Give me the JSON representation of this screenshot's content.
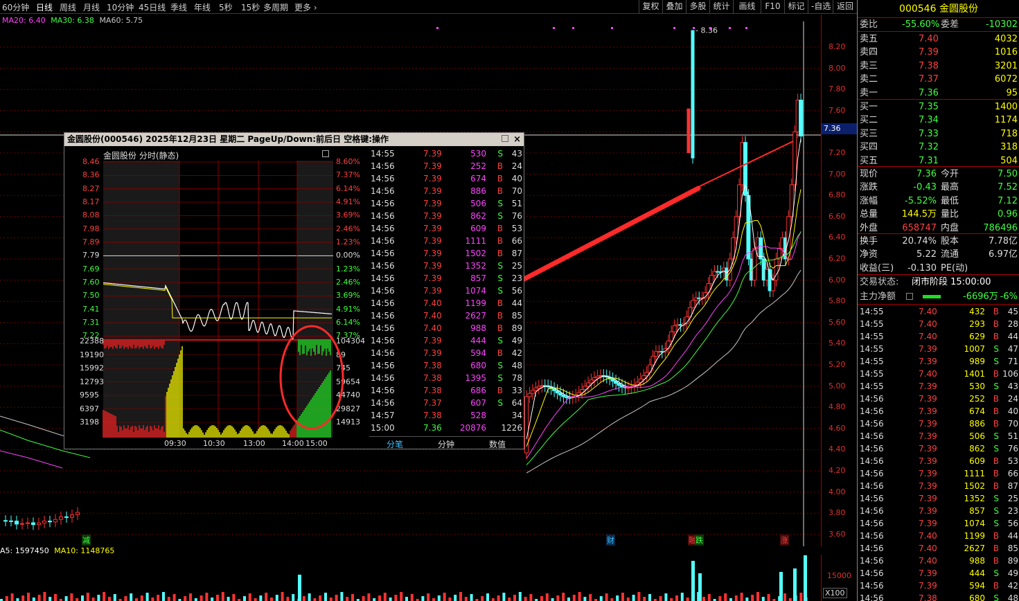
{
  "periods": [
    "60分钟",
    "日线",
    "周线",
    "月线",
    "10分钟",
    "45日线",
    "季线",
    "年线",
    "5秒",
    "15秒",
    "多周期",
    "更多"
  ],
  "active_period": "日线",
  "toolbar": [
    "复权",
    "叠加",
    "多股",
    "统计",
    "画线",
    "F10",
    "标记",
    "-自选",
    "返回"
  ],
  "colors": {
    "up": "#ff3232",
    "down": "#54ffff",
    "ma5": "#ffffff",
    "ma10": "#ffff00",
    "ma20": "#ff00ff",
    "ma30": "#00ff00",
    "ma60": "#c8c8c8",
    "grid": "#8b0000",
    "bg": "#000000",
    "axis": "#e03030"
  },
  "main_chart": {
    "ma_legend": [
      {
        "label": "MA20: 6.40",
        "color": "#ff44ff"
      },
      {
        "label": "MA30: 6.38",
        "color": "#44ff44"
      },
      {
        "label": "MA60: 5.75",
        "color": "#c8c8c8"
      }
    ],
    "price_axis": [
      "8.20",
      "8.00",
      "7.80",
      "7.60",
      "7.40",
      "7.20",
      "7.00",
      "6.80",
      "6.60",
      "6.40",
      "6.20",
      "6.00",
      "5.80",
      "5.60",
      "5.40",
      "5.20",
      "5.00",
      "4.80",
      "4.60",
      "4.40",
      "4.20",
      "4.00",
      "3.80",
      "3.60"
    ],
    "current_price": "7.36",
    "high_marker": "8.36",
    "events": [
      {
        "label": "减",
        "color": "#40ff40"
      },
      {
        "label": "财",
        "color": "#40c0ff"
      },
      {
        "label": "融",
        "color": "#ff4040"
      },
      {
        "label": "跌",
        "color": "#40ff40"
      },
      {
        "label": "涨",
        "color": "#ff4040"
      }
    ],
    "volume_legend": [
      {
        "label": "A5: 1597450",
        "color": "#ffffff"
      },
      {
        "label": "MA10: 1148765",
        "color": "#ffff00"
      }
    ],
    "volume_axis": [
      "15000",
      "X100"
    ]
  },
  "popup": {
    "title": "金圆股份(000546)  2025年12月23日  星期二  PageUp/Down:前后日  空格键:操作",
    "close": "×",
    "mini_title": "金圆股份   分时(静态)",
    "price_labels": [
      "8.46",
      "8.36",
      "8.27",
      "8.17",
      "8.08",
      "7.98",
      "7.89",
      "7.79",
      "7.69",
      "7.60",
      "7.50",
      "7.41",
      "7.31",
      "7.22"
    ],
    "pct_labels": [
      "8.60%",
      "7.37%",
      "6.14%",
      "4.91%",
      "3.69%",
      "2.46%",
      "1.23%",
      "0.00%",
      "1.23%",
      "2.46%",
      "3.69%",
      "4.91%",
      "6.14%",
      "7.37%"
    ],
    "vol_labels": [
      "22388",
      "19190",
      "15992",
      "12793",
      "9595",
      "6397",
      "3198"
    ],
    "vol_right": [
      "104304",
      "89",
      "745",
      "59654",
      "44740",
      "29827",
      "14913"
    ],
    "time_labels": [
      "09:30",
      "10:30",
      "13:00",
      "14:00",
      "15:00"
    ],
    "ticks": [
      {
        "t": "14:55",
        "p": "7.39",
        "v": "530",
        "s": "S",
        "n": "43"
      },
      {
        "t": "14:56",
        "p": "7.39",
        "v": "252",
        "s": "B",
        "n": "24"
      },
      {
        "t": "14:56",
        "p": "7.39",
        "v": "674",
        "s": "B",
        "n": "40"
      },
      {
        "t": "14:56",
        "p": "7.39",
        "v": "886",
        "s": "B",
        "n": "70"
      },
      {
        "t": "14:56",
        "p": "7.39",
        "v": "506",
        "s": "S",
        "n": "51"
      },
      {
        "t": "14:56",
        "p": "7.39",
        "v": "862",
        "s": "S",
        "n": "76"
      },
      {
        "t": "14:56",
        "p": "7.39",
        "v": "609",
        "s": "B",
        "n": "53"
      },
      {
        "t": "14:56",
        "p": "7.39",
        "v": "1111",
        "s": "B",
        "n": "66"
      },
      {
        "t": "14:56",
        "p": "7.39",
        "v": "1502",
        "s": "B",
        "n": "87"
      },
      {
        "t": "14:56",
        "p": "7.39",
        "v": "1352",
        "s": "S",
        "n": "25"
      },
      {
        "t": "14:56",
        "p": "7.39",
        "v": "857",
        "s": "S",
        "n": "23"
      },
      {
        "t": "14:56",
        "p": "7.39",
        "v": "1074",
        "s": "S",
        "n": "56"
      },
      {
        "t": "14:56",
        "p": "7.40",
        "v": "1199",
        "s": "B",
        "n": "44"
      },
      {
        "t": "14:56",
        "p": "7.40",
        "v": "2627",
        "s": "B",
        "n": "85"
      },
      {
        "t": "14:56",
        "p": "7.40",
        "v": "988",
        "s": "B",
        "n": "89"
      },
      {
        "t": "14:56",
        "p": "7.39",
        "v": "444",
        "s": "S",
        "n": "49"
      },
      {
        "t": "14:56",
        "p": "7.39",
        "v": "594",
        "s": "B",
        "n": "42"
      },
      {
        "t": "14:56",
        "p": "7.38",
        "v": "680",
        "s": "S",
        "n": "48"
      },
      {
        "t": "14:56",
        "p": "7.38",
        "v": "1395",
        "s": "S",
        "n": "78"
      },
      {
        "t": "14:56",
        "p": "7.38",
        "v": "686",
        "s": "B",
        "n": "33"
      },
      {
        "t": "14:56",
        "p": "7.37",
        "v": "607",
        "s": "S",
        "n": "64"
      },
      {
        "t": "14:57",
        "p": "7.38",
        "v": "528",
        "s": "",
        "n": "34"
      },
      {
        "t": "15:00",
        "p": "7.36",
        "v": "20876",
        "s": "",
        "n": "1226"
      }
    ],
    "tabs": [
      "分笔",
      "分钟",
      "数值"
    ]
  },
  "side": {
    "code": "000546",
    "name": "金圆股份",
    "weibi_label": "委比",
    "weibi": "-55.60%",
    "weicha_label": "委差",
    "weicha": "-10302",
    "asks": [
      {
        "label": "卖五",
        "price": "7.40",
        "vol": "4032"
      },
      {
        "label": "卖四",
        "price": "7.39",
        "vol": "1016"
      },
      {
        "label": "卖三",
        "price": "7.38",
        "vol": "3201"
      },
      {
        "label": "卖二",
        "price": "7.37",
        "vol": "6072"
      },
      {
        "label": "卖一",
        "price": "7.36",
        "vol": "95"
      }
    ],
    "bids": [
      {
        "label": "买一",
        "price": "7.35",
        "vol": "1400"
      },
      {
        "label": "买二",
        "price": "7.34",
        "vol": "1174"
      },
      {
        "label": "买三",
        "price": "7.33",
        "vol": "718"
      },
      {
        "label": "买四",
        "price": "7.32",
        "vol": "318"
      },
      {
        "label": "买五",
        "price": "7.31",
        "vol": "504"
      }
    ],
    "stats": [
      {
        "l1": "现价",
        "v1": "7.36",
        "c1": "#40ff40",
        "l2": "今开",
        "v2": "7.50",
        "c2": "#40ff40"
      },
      {
        "l1": "涨跌",
        "v1": "-0.43",
        "c1": "#40ff40",
        "l2": "最高",
        "v2": "7.52",
        "c2": "#40ff40"
      },
      {
        "l1": "涨幅",
        "v1": "-5.52%",
        "c1": "#40ff40",
        "l2": "最低",
        "v2": "7.12",
        "c2": "#40ff40"
      },
      {
        "l1": "总量",
        "v1": "144.5万",
        "c1": "#ffff00",
        "l2": "量比",
        "v2": "0.96",
        "c2": "#40ff40"
      },
      {
        "l1": "外盘",
        "v1": "658747",
        "c1": "#ff4040",
        "l2": "内盘",
        "v2": "786496",
        "c2": "#40ff40"
      }
    ],
    "stats2": [
      {
        "l1": "换手",
        "v1": "20.74%",
        "l2": "股本",
        "v2": "7.78亿"
      },
      {
        "l1": "净资",
        "v1": "5.22",
        "l2": "流通",
        "v2": "6.97亿"
      },
      {
        "l1": "收益(三)",
        "v1": "-0.130",
        "l2": "PE(动)",
        "v2": ""
      }
    ],
    "trade_status_label": "交易状态:",
    "trade_status": "闭市阶段 15:00:00",
    "main_flow_label": "主力净额",
    "main_flow": "-6696万",
    "main_flow_pct": "-6%",
    "ticks": [
      {
        "t": "14:55",
        "p": "7.40",
        "v": "432",
        "s": "B",
        "n": "45"
      },
      {
        "t": "14:55",
        "p": "7.40",
        "v": "293",
        "s": "B",
        "n": "28"
      },
      {
        "t": "14:55",
        "p": "7.40",
        "v": "629",
        "s": "B",
        "n": "44"
      },
      {
        "t": "14:55",
        "p": "7.39",
        "v": "1007",
        "s": "S",
        "n": "47"
      },
      {
        "t": "14:55",
        "p": "7.39",
        "v": "989",
        "s": "S",
        "n": "71"
      },
      {
        "t": "14:55",
        "p": "7.40",
        "v": "1401",
        "s": "B",
        "n": "106"
      },
      {
        "t": "14:55",
        "p": "7.39",
        "v": "530",
        "s": "S",
        "n": "43"
      },
      {
        "t": "14:56",
        "p": "7.39",
        "v": "252",
        "s": "B",
        "n": "24"
      },
      {
        "t": "14:56",
        "p": "7.39",
        "v": "674",
        "s": "B",
        "n": "40"
      },
      {
        "t": "14:56",
        "p": "7.39",
        "v": "886",
        "s": "B",
        "n": "70"
      },
      {
        "t": "14:56",
        "p": "7.39",
        "v": "506",
        "s": "S",
        "n": "51"
      },
      {
        "t": "14:56",
        "p": "7.39",
        "v": "862",
        "s": "S",
        "n": "76"
      },
      {
        "t": "14:56",
        "p": "7.39",
        "v": "609",
        "s": "B",
        "n": "53"
      },
      {
        "t": "14:56",
        "p": "7.39",
        "v": "1111",
        "s": "B",
        "n": "66"
      },
      {
        "t": "14:56",
        "p": "7.39",
        "v": "1502",
        "s": "B",
        "n": "87"
      },
      {
        "t": "14:56",
        "p": "7.39",
        "v": "1352",
        "s": "S",
        "n": "25"
      },
      {
        "t": "14:56",
        "p": "7.39",
        "v": "857",
        "s": "S",
        "n": "23"
      },
      {
        "t": "14:56",
        "p": "7.39",
        "v": "1074",
        "s": "S",
        "n": "56"
      },
      {
        "t": "14:56",
        "p": "7.40",
        "v": "1199",
        "s": "B",
        "n": "44"
      },
      {
        "t": "14:56",
        "p": "7.40",
        "v": "2627",
        "s": "B",
        "n": "85"
      },
      {
        "t": "14:56",
        "p": "7.40",
        "v": "988",
        "s": "B",
        "n": "89"
      },
      {
        "t": "14:56",
        "p": "7.39",
        "v": "444",
        "s": "S",
        "n": "49"
      },
      {
        "t": "14:56",
        "p": "7.39",
        "v": "594",
        "s": "B",
        "n": "42"
      },
      {
        "t": "14:56",
        "p": "7.38",
        "v": "680",
        "s": "S",
        "n": "48"
      }
    ]
  }
}
